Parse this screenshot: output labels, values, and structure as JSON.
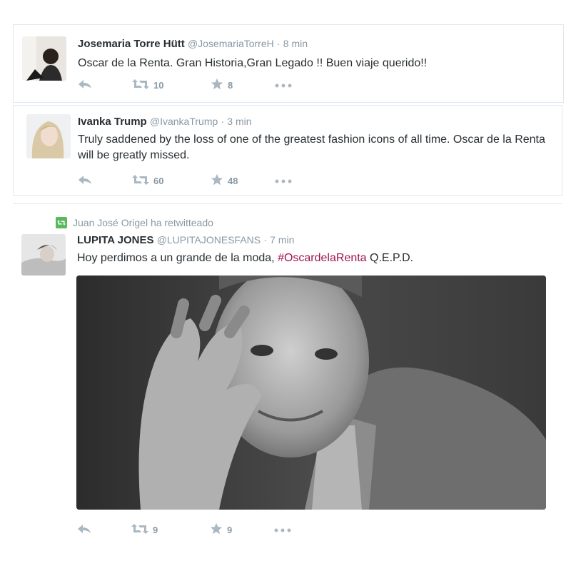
{
  "tweets": [
    {
      "name": "Josemaria Torre Hütt",
      "handle": "@JosemariaTorreH",
      "time": "8 min",
      "text": "Oscar de la Renta. Gran Historia,Gran Legado !! Buen viaje querido!!",
      "retweets": "10",
      "favorites": "8"
    },
    {
      "name": "Ivanka Trump",
      "handle": "@IvankaTrump",
      "time": "3 min",
      "text": "Truly saddened by the loss of one of the greatest fashion icons of all time. Oscar de la Renta will be greatly missed.",
      "retweets": "60",
      "favorites": "48"
    },
    {
      "retweeted_by": "Juan José Origel ha retwitteado",
      "name": "LUPITA JONES",
      "handle": "@LUPITAJONESFANS",
      "time": "7 min",
      "text_before": "Hoy perdimos a un grande de la moda, ",
      "hashtag": "#OscardelaRenta",
      "text_after": " Q.E.P.D.",
      "retweets": "9",
      "favorites": "9"
    }
  ],
  "separator": "·",
  "colors": {
    "hashtag": "#a0144f",
    "muted": "#8899a6",
    "retweet_badge": "#5cb85c"
  },
  "icons": [
    "reply-icon",
    "retweet-icon",
    "favorite-star-icon",
    "more-dots-icon"
  ]
}
